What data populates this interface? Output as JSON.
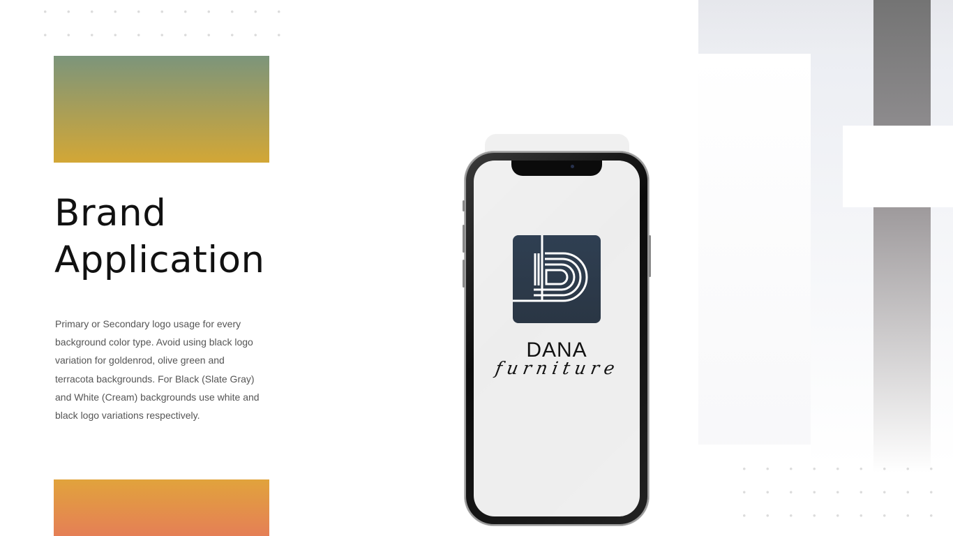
{
  "slide": {
    "title_line1": "Brand",
    "title_line2": "Application",
    "description": "Primary or Secondary logo usage for every background color type. Avoid using black logo variation for goldenrod, olive green and terracota backgrounds. For Black (Slate Gray) and White (Cream) backgrounds use white and black logo variations respectively."
  },
  "logo": {
    "brand_name": "DANA",
    "brand_subname": "furniture"
  },
  "colors": {
    "olive_green": "#7c957b",
    "goldenrod": "#d3a736",
    "terracota": "#e57f56",
    "slate_gray": "#2f3f52"
  },
  "icons": [
    "dana-d-logo-icon"
  ]
}
